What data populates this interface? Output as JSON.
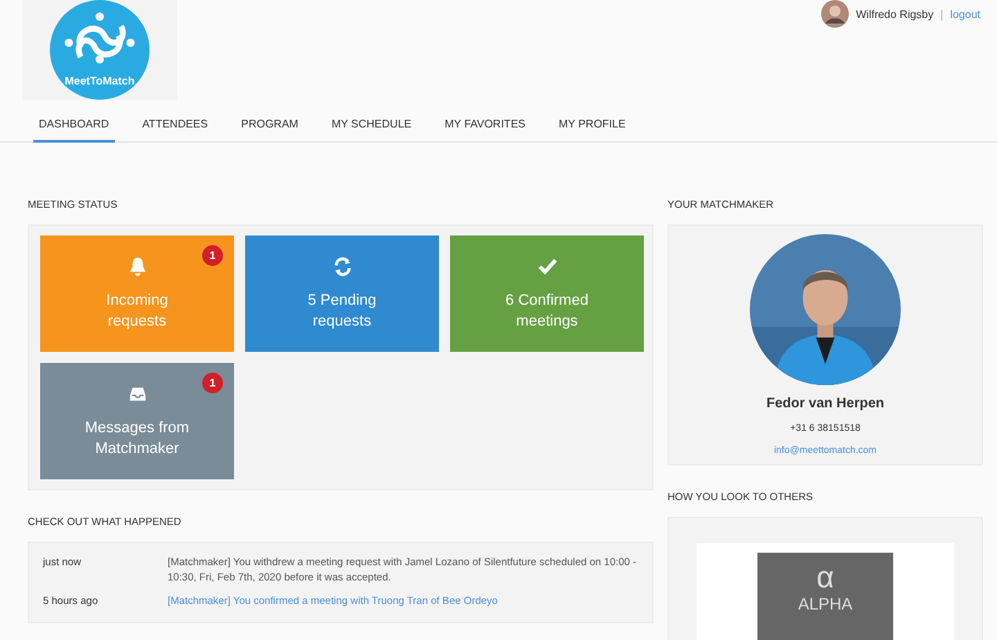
{
  "header": {
    "logo": {
      "name": "MeetToMatch"
    },
    "user": {
      "name": "Wilfredo Rigsby",
      "separator": "|",
      "logout": "logout"
    }
  },
  "nav": [
    {
      "label": "DASHBOARD",
      "selected": true
    },
    {
      "label": "ATTENDEES",
      "selected": false
    },
    {
      "label": "PROGRAM",
      "selected": false
    },
    {
      "label": "MY SCHEDULE",
      "selected": false
    },
    {
      "label": "MY FAVORITES",
      "selected": false
    },
    {
      "label": "MY PROFILE",
      "selected": false
    }
  ],
  "meeting_status": {
    "heading": "MEETING STATUS",
    "tiles": [
      {
        "kind": "bell",
        "label": "Incoming requests",
        "badge": "1",
        "color": "#f7941d"
      },
      {
        "kind": "refresh",
        "label": "5 Pending requests",
        "color": "#2f8ad0"
      },
      {
        "kind": "check",
        "label": "6 Confirmed meetings",
        "color": "#65a043"
      },
      {
        "kind": "inbox",
        "label": "Messages from Matchmaker",
        "badge": "1",
        "color": "#7a8c98"
      }
    ]
  },
  "activity": {
    "heading": "CHECK OUT WHAT HAPPENED",
    "rows": [
      {
        "time": "just now",
        "text": "[Matchmaker] You withdrew a meeting request with Jamel Lozano of Silentfuture scheduled on 10:00 - 10:30, Fri, Feb 7th, 2020 before it was accepted.",
        "kind": "plain"
      },
      {
        "time": "5 hours ago",
        "text": "[Matchmaker] You confirmed a meeting with Truong Tran of Bee Ordeyo",
        "kind": "link"
      }
    ]
  },
  "matchmaker": {
    "heading": "YOUR MATCHMAKER",
    "name": "Fedor van Herpen",
    "phone": "+31 6 38151518",
    "email": "info@meettomatch.com"
  },
  "profile": {
    "heading": "HOW YOU LOOK TO OTHERS",
    "logo_symbol": "α",
    "logo_text": "ALPHA"
  }
}
